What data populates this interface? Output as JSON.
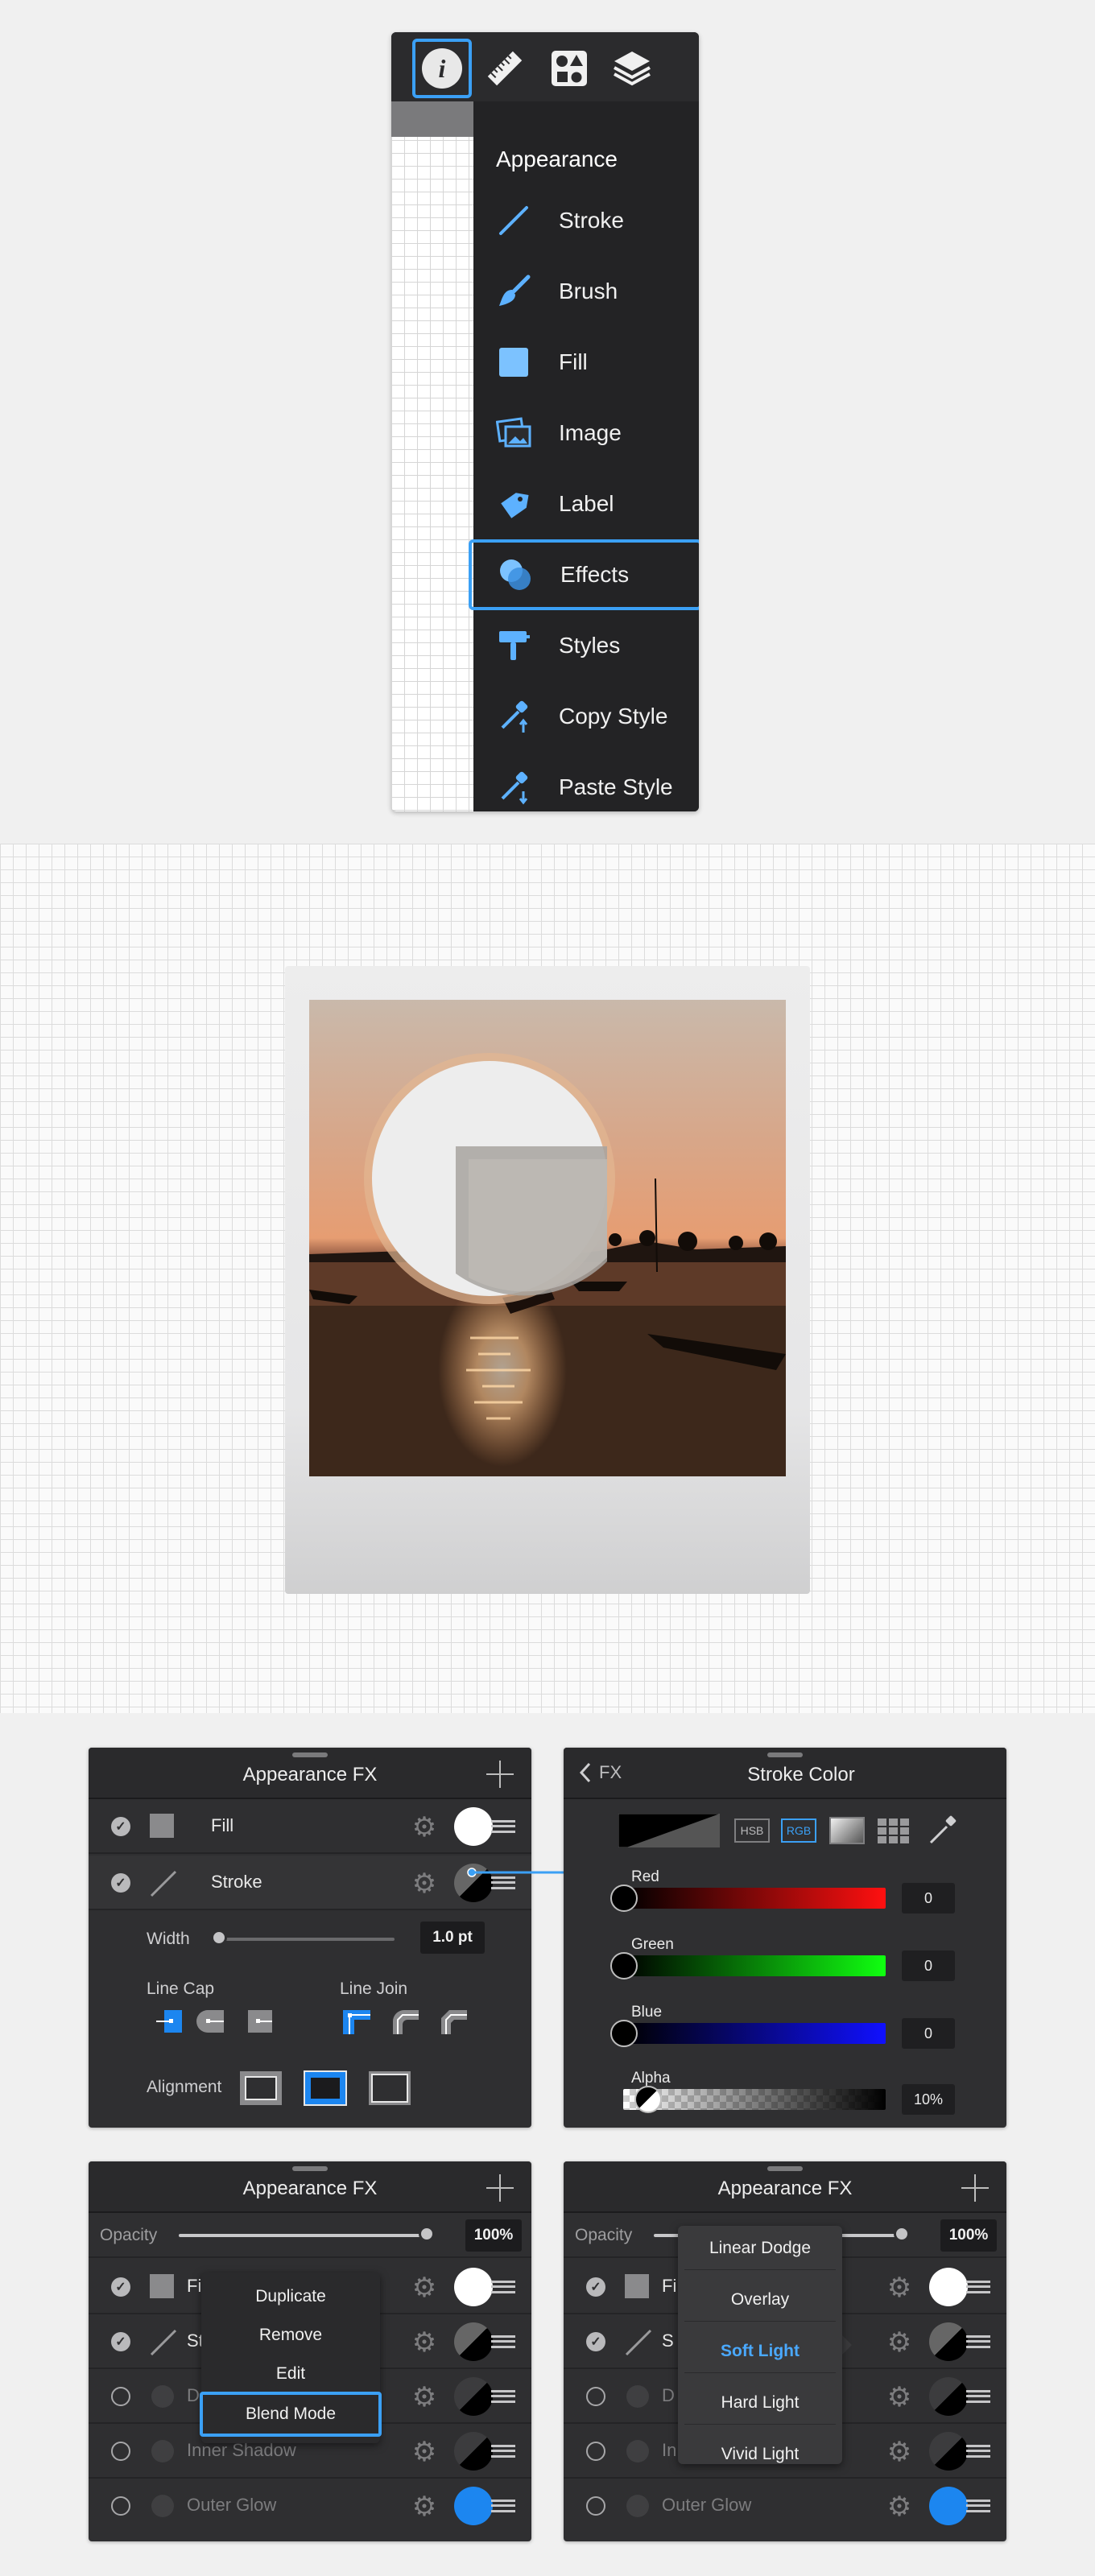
{
  "toolbar": {
    "icons": [
      "info-icon",
      "ruler-icon",
      "shapes-icon",
      "layers-icon"
    ],
    "selected": "info-icon"
  },
  "appearance_menu": {
    "title": "Appearance",
    "items": [
      {
        "label": "Stroke",
        "icon": "stroke-icon"
      },
      {
        "label": "Brush",
        "icon": "brush-icon"
      },
      {
        "label": "Fill",
        "icon": "fill-icon"
      },
      {
        "label": "Image",
        "icon": "image-icon"
      },
      {
        "label": "Label",
        "icon": "label-icon"
      },
      {
        "label": "Effects",
        "icon": "effects-icon"
      },
      {
        "label": "Styles",
        "icon": "styles-icon"
      },
      {
        "label": "Copy Style",
        "icon": "copy-style-icon"
      },
      {
        "label": "Paste Style",
        "icon": "paste-style-icon"
      }
    ],
    "selected": "Effects"
  },
  "colors": {
    "accent": "#3ba0f5",
    "panel_bg": "#2f2f31",
    "red": "#ff1010",
    "green": "#10ff10",
    "blue": "#1010ff",
    "outer_glow": "#1c86f0"
  },
  "fx_panel_1": {
    "title": "Appearance FX",
    "rows": [
      {
        "label": "Fill",
        "checked": true
      },
      {
        "label": "Stroke",
        "checked": true
      }
    ],
    "width_label": "Width",
    "width_value": "1.0 pt",
    "width_fraction": 0.0,
    "line_cap_label": "Line Cap",
    "line_join_label": "Line Join",
    "alignment_label": "Alignment",
    "selected_cap": 0,
    "selected_join": 0,
    "selected_alignment": 1
  },
  "stroke_color_panel": {
    "back_label": "FX",
    "title": "Stroke Color",
    "modes": [
      "HSB",
      "RGB"
    ],
    "selected_mode": "RGB",
    "channels": [
      {
        "label": "Red",
        "value": "0"
      },
      {
        "label": "Green",
        "value": "0"
      },
      {
        "label": "Blue",
        "value": "0"
      },
      {
        "label": "Alpha",
        "value": "10%"
      }
    ]
  },
  "fx_panel_2": {
    "title": "Appearance FX",
    "opacity_label": "Opacity",
    "opacity_value": "100%",
    "opacity_fraction": 1.0,
    "rows": [
      {
        "label": "Fi",
        "checked": true
      },
      {
        "label": "St",
        "checked": true
      },
      {
        "label": "D",
        "checked": false
      },
      {
        "label": "Inner Shadow",
        "checked": false
      },
      {
        "label": "Outer Glow",
        "checked": false
      }
    ],
    "context_menu": [
      "Duplicate",
      "Remove",
      "Edit",
      "Blend Mode"
    ],
    "context_selected": "Blend Mode"
  },
  "fx_panel_3": {
    "title": "Appearance FX",
    "opacity_label": "Opacity",
    "opacity_value": "100%",
    "opacity_fraction": 1.0,
    "rows": [
      {
        "label": "Fi",
        "checked": true
      },
      {
        "label": "S",
        "checked": true
      },
      {
        "label": "D",
        "checked": false
      },
      {
        "label": "In",
        "checked": false
      },
      {
        "label": "Outer Glow",
        "checked": false
      }
    ],
    "blend_modes": [
      "Linear Dodge",
      "Overlay",
      "Soft Light",
      "Hard Light",
      "Vivid Light"
    ],
    "blend_selected": "Soft Light"
  }
}
